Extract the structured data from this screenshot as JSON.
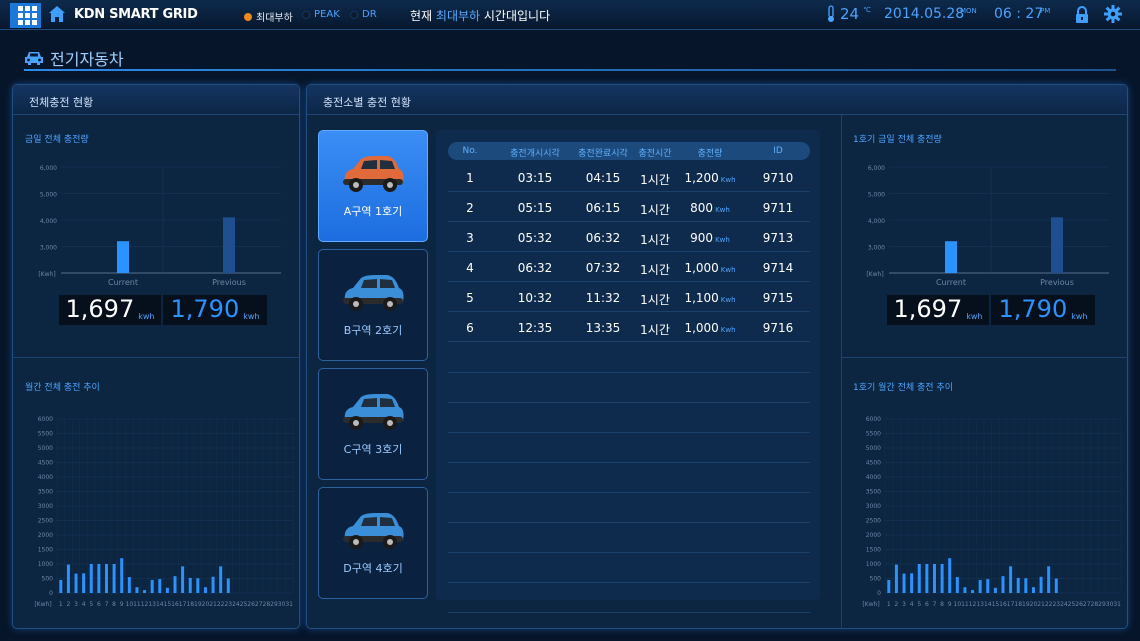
{
  "app": {
    "title": "KDN SMART GRID"
  },
  "indicators": [
    {
      "label": "최대부하",
      "color": "#f08a1c"
    },
    {
      "label": "PEAK",
      "color": "#0a1a30"
    },
    {
      "label": "DR",
      "color": "#0a1a30"
    }
  ],
  "status_message": {
    "prefix": "현재 ",
    "highlight": "최대부하",
    "suffix": " 시간대입니다"
  },
  "temperature": {
    "value": "24",
    "unit": "℃"
  },
  "date": {
    "value": "2014.05.28",
    "weekday": "MON"
  },
  "time": {
    "value": "06 : 27",
    "ampm": "PM"
  },
  "page": {
    "title": "전기자동차"
  },
  "left_panel": {
    "title": "전체충전 현황",
    "daily": {
      "subtitle": "금일 전체 충전량",
      "chart_data": {
        "type": "bar",
        "categories": [
          "Current",
          "Previous"
        ],
        "values": [
          3200,
          4100
        ],
        "ylim": [
          2000,
          6000
        ],
        "ytick_labels": [
          "6,000",
          "5,000",
          "4,000",
          "3,000"
        ],
        "yticks": [
          6000,
          5000,
          4000,
          3000
        ],
        "ylabel": "[Kwh]",
        "colors": [
          "#2a93ff",
          "#1f4f90"
        ]
      },
      "current_label": "Current",
      "previous_label": "Previous",
      "current_value": "1,697",
      "previous_value": "1,790",
      "unit": "kwh"
    },
    "monthly": {
      "subtitle": "월간 전체 충전 추이",
      "chart_data": {
        "type": "bar",
        "categories": [
          "1",
          "2",
          "3",
          "4",
          "5",
          "6",
          "7",
          "8",
          "9",
          "10",
          "11",
          "12",
          "13",
          "14",
          "15",
          "16",
          "17",
          "18",
          "19",
          "20",
          "21",
          "22",
          "23",
          "24",
          "25",
          "26",
          "27",
          "28",
          "29",
          "30",
          "31"
        ],
        "values": [
          450,
          980,
          670,
          680,
          1000,
          1000,
          1000,
          1000,
          1200,
          550,
          200,
          100,
          450,
          480,
          180,
          580,
          920,
          520,
          510,
          200,
          560,
          920,
          500,
          0,
          0,
          0,
          0,
          0,
          0,
          0,
          0
        ],
        "ylim": [
          0,
          6000
        ],
        "yticks": [
          0,
          500,
          1000,
          1500,
          2000,
          2500,
          3000,
          3500,
          4000,
          4500,
          5000,
          5500,
          6000
        ],
        "ylabel": "[Kwh]"
      }
    }
  },
  "center_panel": {
    "title": "충전소별 충전 현황",
    "chargers": [
      {
        "label": "A구역 1호기",
        "car_color": "#e06a3a",
        "active": true
      },
      {
        "label": "B구역 2호기",
        "car_color": "#3a8fd8",
        "active": false
      },
      {
        "label": "C구역 3호기",
        "car_color": "#3a8fd8",
        "active": false
      },
      {
        "label": "D구역 4호기",
        "car_color": "#3a8fd8",
        "active": false
      }
    ],
    "table": {
      "headers": [
        "No.",
        "충전개시시각",
        "충전완료시각",
        "충전시간",
        "충전량",
        "ID"
      ],
      "unit": "Kwh",
      "rows": [
        {
          "no": "1",
          "start": "03:15",
          "end": "04:15",
          "duration": "1시간",
          "amount": "1,200",
          "id": "9710"
        },
        {
          "no": "2",
          "start": "05:15",
          "end": "06:15",
          "duration": "1시간",
          "amount": "800",
          "id": "9711"
        },
        {
          "no": "3",
          "start": "05:32",
          "end": "06:32",
          "duration": "1시간",
          "amount": "900",
          "id": "9713"
        },
        {
          "no": "4",
          "start": "06:32",
          "end": "07:32",
          "duration": "1시간",
          "amount": "1,000",
          "id": "9714"
        },
        {
          "no": "5",
          "start": "10:32",
          "end": "11:32",
          "duration": "1시간",
          "amount": "1,100",
          "id": "9715"
        },
        {
          "no": "6",
          "start": "12:35",
          "end": "13:35",
          "duration": "1시간",
          "amount": "1,000",
          "id": "9716"
        }
      ]
    },
    "daily": {
      "subtitle": "1호기 금일 전체 충전량",
      "chart_data": {
        "type": "bar",
        "categories": [
          "Current",
          "Previous"
        ],
        "values": [
          3200,
          4100
        ],
        "ylim": [
          2000,
          6000
        ],
        "ytick_labels": [
          "6,000",
          "5,000",
          "4,000",
          "3,000"
        ],
        "yticks": [
          6000,
          5000,
          4000,
          3000
        ],
        "ylabel": "[Kwh]",
        "colors": [
          "#2a93ff",
          "#1f4f90"
        ]
      },
      "current_label": "Current",
      "previous_label": "Previous",
      "current_value": "1,697",
      "previous_value": "1,790",
      "unit": "kwh"
    },
    "monthly": {
      "subtitle": "1호기 월간 전체 충전 추이",
      "chart_data": {
        "type": "bar",
        "categories": [
          "1",
          "2",
          "3",
          "4",
          "5",
          "6",
          "7",
          "8",
          "9",
          "10",
          "11",
          "12",
          "13",
          "14",
          "15",
          "16",
          "17",
          "18",
          "19",
          "20",
          "21",
          "22",
          "23",
          "24",
          "25",
          "26",
          "27",
          "28",
          "29",
          "30",
          "31"
        ],
        "values": [
          450,
          980,
          670,
          680,
          1000,
          1000,
          1000,
          1000,
          1200,
          550,
          200,
          100,
          450,
          480,
          180,
          580,
          920,
          520,
          510,
          200,
          560,
          920,
          500,
          0,
          0,
          0,
          0,
          0,
          0,
          0,
          0
        ],
        "ylim": [
          0,
          6000
        ],
        "yticks": [
          0,
          500,
          1000,
          1500,
          2000,
          2500,
          3000,
          3500,
          4000,
          4500,
          5000,
          5500,
          6000
        ],
        "ylabel": "[Kwh]"
      }
    }
  }
}
